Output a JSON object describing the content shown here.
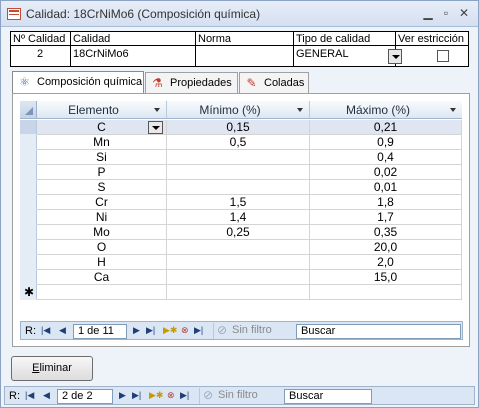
{
  "window": {
    "title": "Calidad: 18CrNiMo6 (Composición química)",
    "min_icon": "minimize-icon",
    "max_icon": "maximize-icon",
    "close_icon": "close-icon"
  },
  "header": {
    "labels": [
      "Nº Calidad",
      "Calidad",
      "Norma",
      "Tipo de calidad",
      "Ver estricción"
    ],
    "values": {
      "numero": "2",
      "calidad": "18CrNiMo6",
      "norma": "",
      "tipo": "GENERAL",
      "ver_estriccion": false
    }
  },
  "tabs": [
    {
      "label": "Composición química",
      "icon": "atom-icon",
      "active": true
    },
    {
      "label": "Propiedades",
      "icon": "flask-icon",
      "active": false
    },
    {
      "label": "Coladas",
      "icon": "brush-icon",
      "active": false
    }
  ],
  "grid": {
    "columns": [
      "Elemento",
      "Mínimo (%)",
      "Máximo (%)"
    ],
    "rows": [
      {
        "elemento": "C",
        "minimo": "0,15",
        "maximo": "0,21"
      },
      {
        "elemento": "Mn",
        "minimo": "0,5",
        "maximo": "0,9"
      },
      {
        "elemento": "Si",
        "minimo": "",
        "maximo": "0,4"
      },
      {
        "elemento": "P",
        "minimo": "",
        "maximo": "0,02"
      },
      {
        "elemento": "S",
        "minimo": "",
        "maximo": "0,01"
      },
      {
        "elemento": "Cr",
        "minimo": "1,5",
        "maximo": "1,8"
      },
      {
        "elemento": "Ni",
        "minimo": "1,4",
        "maximo": "1,7"
      },
      {
        "elemento": "Mo",
        "minimo": "0,25",
        "maximo": "0,35"
      },
      {
        "elemento": "O",
        "minimo": "",
        "maximo": "20,0"
      },
      {
        "elemento": "H",
        "minimo": "",
        "maximo": "2,0"
      },
      {
        "elemento": "Ca",
        "minimo": "",
        "maximo": "15,0"
      }
    ],
    "new_row_marker": "✱"
  },
  "subform_nav": {
    "record_label": "R:",
    "record_text": "1 de 11",
    "filter_label": "Sin filtro",
    "search_placeholder": "Buscar"
  },
  "actions": {
    "delete_label_underlined": "E",
    "delete_label_rest": "liminar"
  },
  "form_nav": {
    "record_label": "R:",
    "record_text": "2 de 2",
    "filter_label": "Sin filtro",
    "search_placeholder": "Buscar"
  },
  "colors": {
    "accent": "#1d3f78",
    "titlebar": "#d4dff0",
    "selected_row": "#dfe6f2"
  }
}
